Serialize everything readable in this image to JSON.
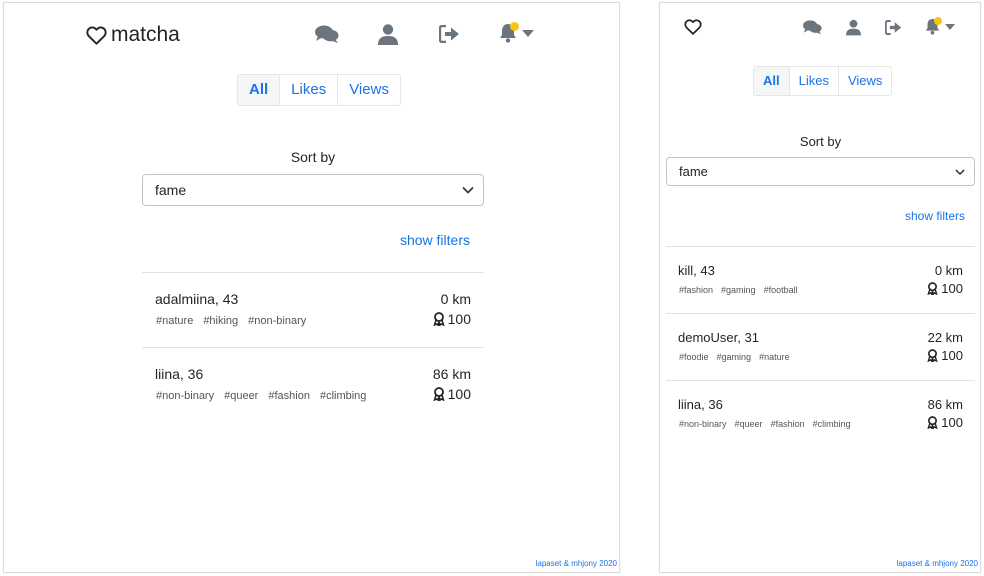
{
  "brand": {
    "name": "matcha"
  },
  "tabs": [
    "All",
    "Likes",
    "Views"
  ],
  "sort": {
    "label": "Sort by",
    "value": "fame"
  },
  "show_filters": "show filters",
  "footer": "lapaset & mhjony 2020",
  "colors": {
    "link": "#1a73e8",
    "icon": "#6c757d",
    "notification_dot": "#f5c518"
  },
  "icons": {
    "nav": [
      "heart-icon",
      "comments-icon",
      "user-icon",
      "sign-out-icon",
      "bell-icon",
      "caret-down-icon"
    ],
    "fame": "award-icon"
  },
  "left": {
    "results": [
      {
        "name": "adalmiina, 43",
        "tags": [
          "#nature",
          "#hiking",
          "#non-binary"
        ],
        "distance": "0 km",
        "fame": "100"
      },
      {
        "name": "liina, 36",
        "tags": [
          "#non-binary",
          "#queer",
          "#fashion",
          "#climbing"
        ],
        "distance": "86 km",
        "fame": "100"
      }
    ]
  },
  "right": {
    "results": [
      {
        "name": "kill, 43",
        "tags": [
          "#fashion",
          "#gaming",
          "#football"
        ],
        "distance": "0 km",
        "fame": "100"
      },
      {
        "name": "demoUser, 31",
        "tags": [
          "#foodie",
          "#gaming",
          "#nature"
        ],
        "distance": "22 km",
        "fame": "100"
      },
      {
        "name": "liina, 36",
        "tags": [
          "#non-binary",
          "#queer",
          "#fashion",
          "#climbing"
        ],
        "distance": "86 km",
        "fame": "100"
      }
    ]
  }
}
